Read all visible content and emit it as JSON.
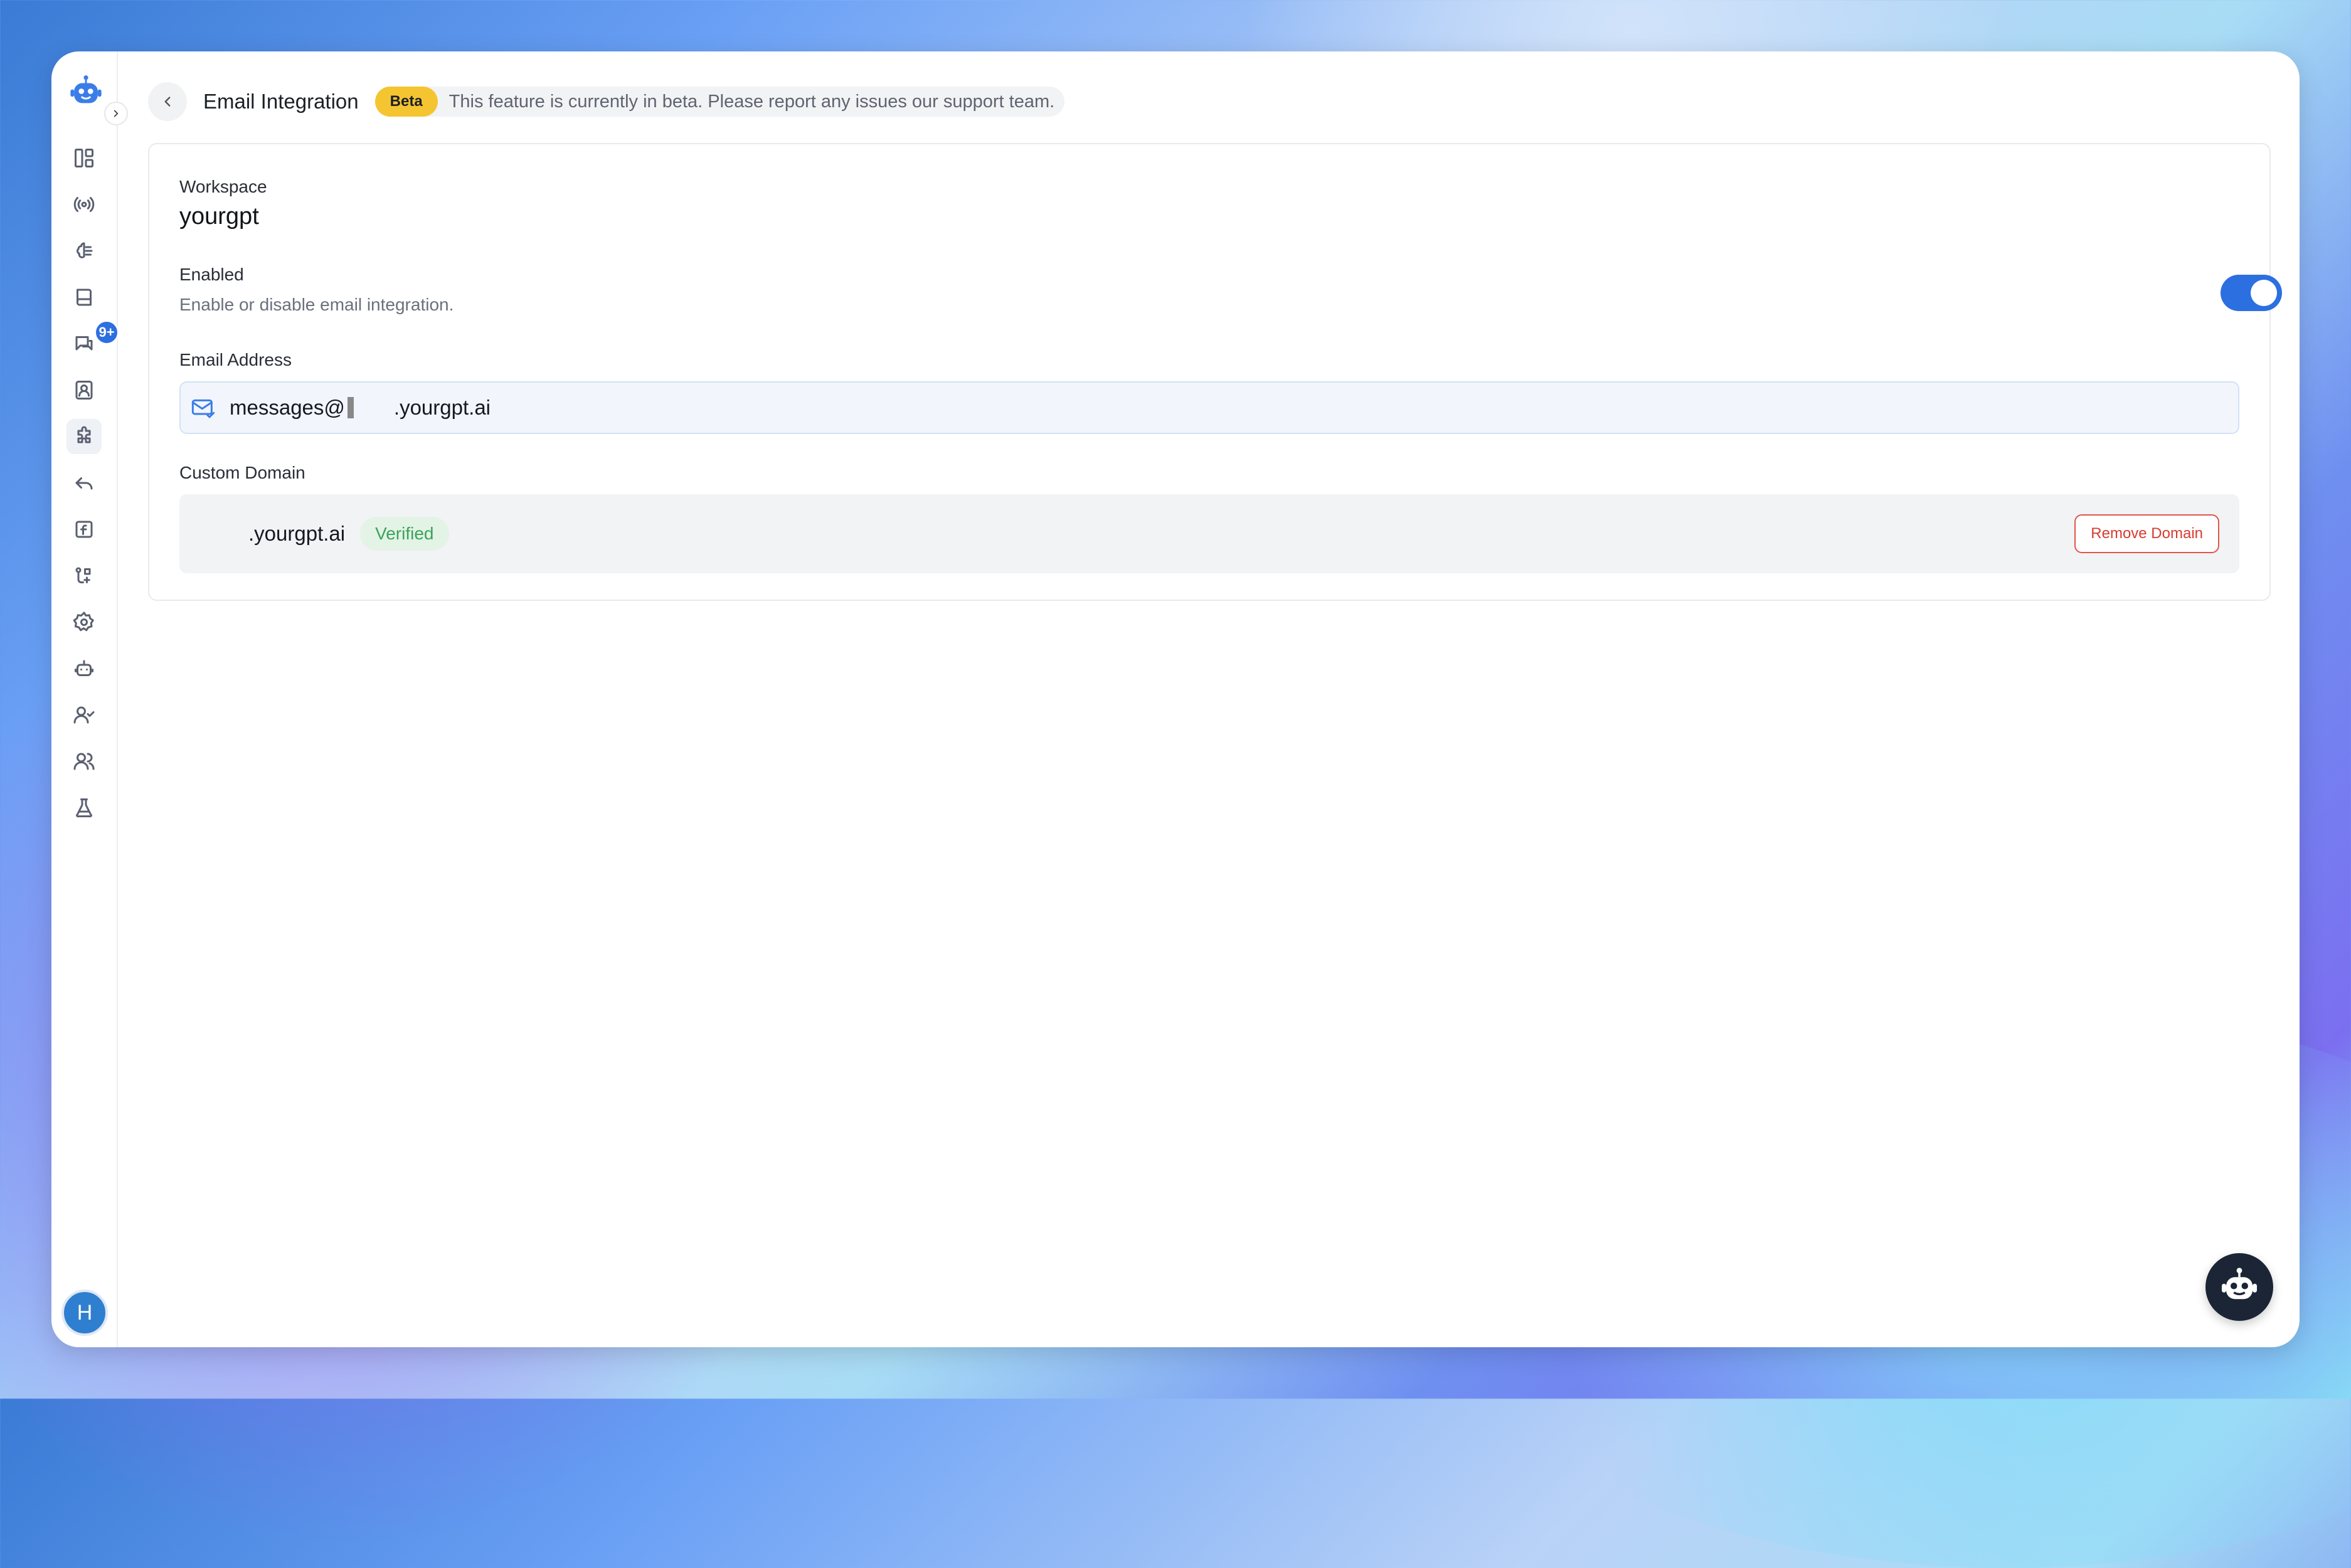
{
  "header": {
    "title": "Email Integration",
    "beta_badge": "Beta",
    "beta_message": "This feature is currently in beta. Please report any issues our support team."
  },
  "sidebar": {
    "badge_count": "9+",
    "avatar_initial": "H",
    "items": [
      {
        "name": "dashboard-icon"
      },
      {
        "name": "broadcast-icon"
      },
      {
        "name": "brain-icon"
      },
      {
        "name": "book-icon"
      },
      {
        "name": "chat-icon"
      },
      {
        "name": "contact-icon"
      },
      {
        "name": "puzzle-icon",
        "active": true
      },
      {
        "name": "reply-icon"
      },
      {
        "name": "function-icon"
      },
      {
        "name": "workflow-icon"
      },
      {
        "name": "settings-icon"
      },
      {
        "name": "bot-icon"
      },
      {
        "name": "user-check-icon"
      },
      {
        "name": "users-icon"
      },
      {
        "name": "flask-icon"
      }
    ]
  },
  "workspace": {
    "label": "Workspace",
    "value": "yourgpt"
  },
  "enabled": {
    "label": "Enabled",
    "description": "Enable or disable email integration.",
    "on": true
  },
  "email": {
    "label": "Email Address",
    "prefix": "messages@",
    "suffix": ".yourgpt.ai"
  },
  "custom_domain": {
    "label": "Custom Domain",
    "domain": ".yourgpt.ai",
    "status": "Verified",
    "remove_label": "Remove Domain"
  },
  "colors": {
    "accent": "#2c6fe0",
    "beta": "#f5c431",
    "verified": "#3ba35a",
    "danger": "#d83b30"
  }
}
